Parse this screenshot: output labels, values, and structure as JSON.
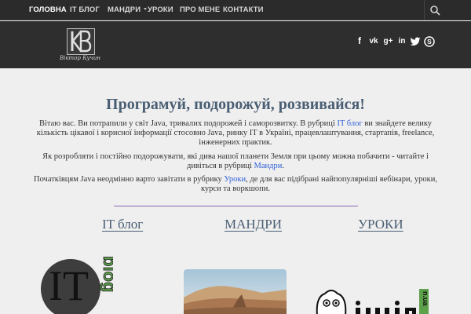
{
  "nav": {
    "items": [
      {
        "label": "ГОЛОВНА",
        "active": true
      },
      {
        "label": "IT БЛОГ",
        "active": false
      },
      {
        "label": "МАНДРИ",
        "active": false,
        "dropdown": true
      },
      {
        "label": "УРОКИ",
        "active": false
      },
      {
        "label": "ПРО МЕНЕ",
        "active": false
      },
      {
        "label": "КОНТАКТИ",
        "active": false
      }
    ],
    "search_icon": "search-icon"
  },
  "header": {
    "logo_text": "Віктор Кучин",
    "social": [
      "facebook-icon",
      "vk-icon",
      "google-plus-icon",
      "linkedin-icon",
      "twitter-icon",
      "skype-icon"
    ]
  },
  "main": {
    "headline": "Програмуй, подорожуй, розвивайся!",
    "p1_before": "Вітаю вас. Ви потрапили у світ Java, тривалих подорожей і саморозвитку. В рубриці ",
    "p1_link": "IT блог",
    "p1_after": " ви знайдете велику кількість цікавої і корисної інформації стосовно Java, ринку IT в Україні, працевлаштування, стартапів, freelance, інженерних практик.",
    "p2_before": "Як розробляти і постійно подорожувати, які дива нашої планети Земля при цьому можна побачити - читайте і дивіться в рубриці ",
    "p2_link": "Мандри",
    "p2_after": ".",
    "p3_before": "Початківцям Java неодмінно варто завітати в рубрику ",
    "p3_link": "Уроки",
    "p3_after": ", де для вас підібрані найпопулярніші вебінари, уроки, курси та воркшопи."
  },
  "sections": [
    {
      "title": "IT блог"
    },
    {
      "title": "МАНДРИ"
    },
    {
      "title": "УРОКИ"
    }
  ],
  "colors": {
    "nav_bg": "#2b2b2b",
    "header_bg": "#2e2e2e",
    "page_bg": "#efefef",
    "headline": "#4a5e74",
    "link": "#2f5fd7",
    "divider": "#8a65b7"
  }
}
